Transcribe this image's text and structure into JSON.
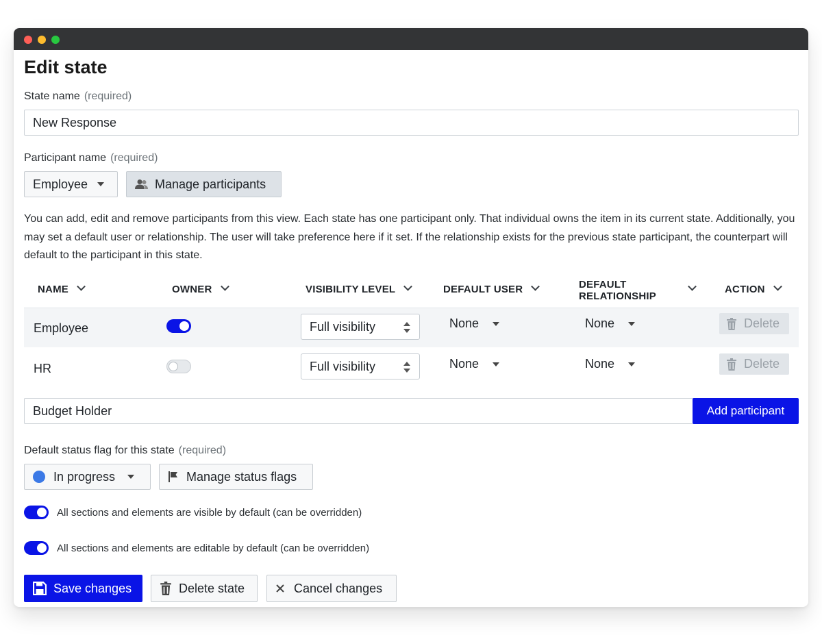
{
  "page": {
    "title": "Edit state"
  },
  "state_name": {
    "label": "State name",
    "required": "(required)",
    "value": "New Response"
  },
  "participant": {
    "label": "Participant name",
    "required": "(required)",
    "selected": "Employee",
    "manage_label": "Manage participants",
    "description": "You can add, edit and remove participants from this view. Each state has one participant only. That individual owns the item in its current state. Additionally, you may set a default user or relationship. The user will take preference here if it set. If the relationship exists for the previous state participant, the counterpart will default to the participant in this state."
  },
  "table": {
    "headers": {
      "name": "NAME",
      "owner": "OWNER",
      "visibility": "VISIBILITY LEVEL",
      "default_user": "DEFAULT USER",
      "default_relationship_1": "DEFAULT",
      "default_relationship_2": "RELATIONSHIP",
      "action": "ACTION"
    },
    "rows": [
      {
        "name": "Employee",
        "owner": true,
        "visibility": "Full visibility",
        "default_user": "None",
        "default_relationship": "None",
        "action": "Delete"
      },
      {
        "name": "HR",
        "owner": false,
        "visibility": "Full visibility",
        "default_user": "None",
        "default_relationship": "None",
        "action": "Delete"
      }
    ]
  },
  "add_participant": {
    "value": "Budget Holder",
    "button": "Add participant"
  },
  "status_flag": {
    "label": "Default status flag for this state",
    "required": "(required)",
    "selected": "In progress",
    "selected_color": "#3b79e6",
    "manage_label": "Manage status flags"
  },
  "options": {
    "visible_default": "All sections and elements are visible by default (can be overridden)",
    "visible_on": true,
    "editable_default": "All sections and elements are editable by default (can be overridden)",
    "editable_on": true
  },
  "actions": {
    "save": "Save changes",
    "delete": "Delete state",
    "cancel": "Cancel changes"
  },
  "colors": {
    "primary": "#0a14e6",
    "titlebar": "#333436"
  }
}
